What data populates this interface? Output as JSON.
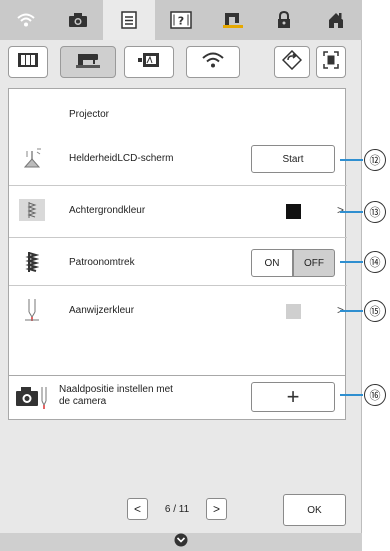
{
  "topbar": {
    "icons": [
      "wifi-icon",
      "camera-icon",
      "page-icon",
      "help-icon",
      "machine-icon",
      "lock-icon",
      "home-icon"
    ],
    "active_index": 2
  },
  "tabs": {
    "icons": [
      "embroidery-frame-icon",
      "sewing-machine-icon",
      "projector-icon",
      "wireless-icon",
      "settings-reset-icon",
      "scan-icon"
    ],
    "active_index": 1
  },
  "panel": {
    "header": "Projector",
    "rows": [
      {
        "label": "HelderheidLCD-scherm",
        "button": "Start",
        "callout": "⑫"
      },
      {
        "label": "Achtergrondkleur",
        "swatch_color": "#111111",
        "callout": "⑬"
      },
      {
        "label": "Patroonomtrek",
        "on": "ON",
        "off": "OFF",
        "selected": "OFF",
        "callout": "⑭"
      },
      {
        "label": "Aanwijzerkleur",
        "swatch_color": "#cfcfcf",
        "callout": "⑮"
      }
    ]
  },
  "camera_row": {
    "label_line1": "Naaldpositie instellen met",
    "label_line2": "de camera",
    "button": "+",
    "callout": "⑯"
  },
  "footer": {
    "prev": "<",
    "page": "6 / 11",
    "next": ">",
    "ok": "OK"
  },
  "colors": {
    "callout_line": "#2f8fd0",
    "panel_bg": "#ffffff",
    "screen_bg": "#e8e8e8"
  }
}
